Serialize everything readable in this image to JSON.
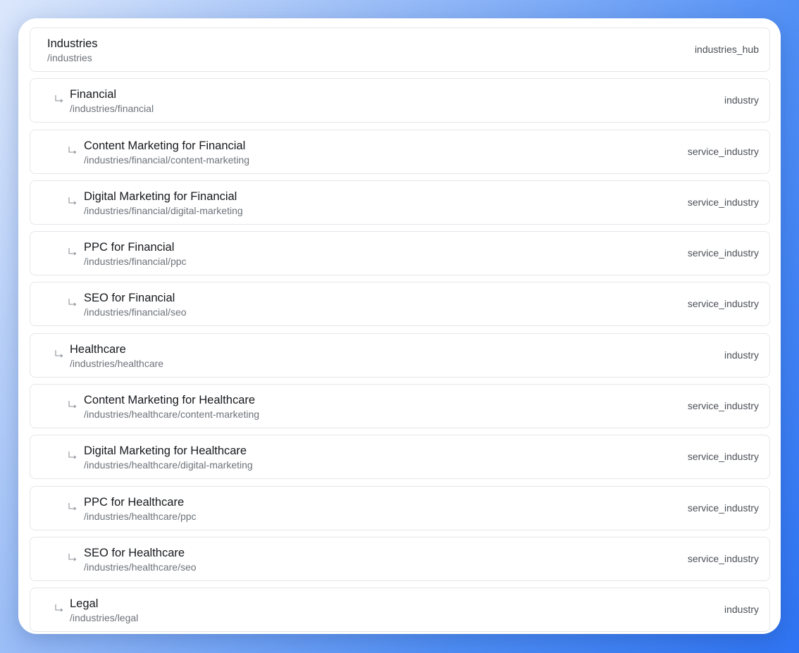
{
  "items": [
    {
      "level": 0,
      "title": "Industries",
      "path": "/industries",
      "type": "industries_hub"
    },
    {
      "level": 1,
      "title": "Financial",
      "path": "/industries/financial",
      "type": "industry"
    },
    {
      "level": 2,
      "title": "Content Marketing for Financial",
      "path": "/industries/financial/content-marketing",
      "type": "service_industry"
    },
    {
      "level": 2,
      "title": "Digital Marketing for Financial",
      "path": "/industries/financial/digital-marketing",
      "type": "service_industry"
    },
    {
      "level": 2,
      "title": "PPC for Financial",
      "path": "/industries/financial/ppc",
      "type": "service_industry"
    },
    {
      "level": 2,
      "title": "SEO for Financial",
      "path": "/industries/financial/seo",
      "type": "service_industry"
    },
    {
      "level": 1,
      "title": "Healthcare",
      "path": "/industries/healthcare",
      "type": "industry"
    },
    {
      "level": 2,
      "title": "Content Marketing for Healthcare",
      "path": "/industries/healthcare/content-marketing",
      "type": "service_industry"
    },
    {
      "level": 2,
      "title": "Digital Marketing for Healthcare",
      "path": "/industries/healthcare/digital-marketing",
      "type": "service_industry"
    },
    {
      "level": 2,
      "title": "PPC for Healthcare",
      "path": "/industries/healthcare/ppc",
      "type": "service_industry"
    },
    {
      "level": 2,
      "title": "SEO for Healthcare",
      "path": "/industries/healthcare/seo",
      "type": "service_industry"
    },
    {
      "level": 1,
      "title": "Legal",
      "path": "/industries/legal",
      "type": "industry"
    }
  ]
}
